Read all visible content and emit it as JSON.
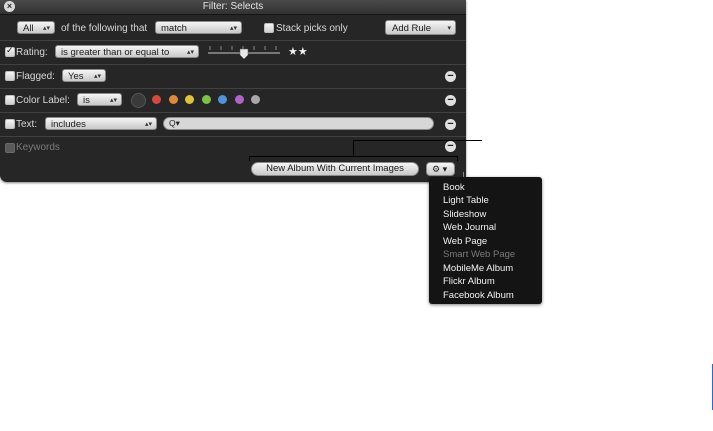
{
  "window": {
    "title": "Filter: Selects"
  },
  "header": {
    "scope_value": "All",
    "of_following_text": "of the following that",
    "match_value": "match",
    "stack_picks_label": "Stack picks only",
    "add_rule_label": "Add Rule"
  },
  "rules": {
    "rating": {
      "label": "Rating:",
      "operator": "is greater than or equal to",
      "stars": "★★",
      "checked": true
    },
    "flagged": {
      "label": "Flagged:",
      "value": "Yes",
      "checked": false
    },
    "color_label": {
      "label": "Color Label:",
      "operator": "is",
      "checked": false,
      "colors": [
        "#3a3a3a",
        "#d9473f",
        "#e0893a",
        "#e0c33c",
        "#7cc246",
        "#4f93d8",
        "#b064c8",
        "#a8a8a8"
      ]
    },
    "text": {
      "label": "Text:",
      "operator": "includes",
      "search_icon_text": "Q▾",
      "checked": false
    },
    "keywords": {
      "label": "Keywords",
      "checked": false
    }
  },
  "footer": {
    "new_album_label": "New Album With Current Images",
    "action_menu_label": "⚙ ▾"
  },
  "action_menu": {
    "items": [
      {
        "label": "Book",
        "enabled": true
      },
      {
        "label": "Light Table",
        "enabled": true
      },
      {
        "label": "Slideshow",
        "enabled": true
      },
      {
        "label": "Web Journal",
        "enabled": true
      },
      {
        "label": "Web Page",
        "enabled": true
      },
      {
        "label": "Smart Web Page",
        "enabled": false
      },
      {
        "label": "MobileMe Album",
        "enabled": true
      },
      {
        "label": "Flickr Album",
        "enabled": true
      },
      {
        "label": "Facebook Album",
        "enabled": true
      }
    ]
  }
}
